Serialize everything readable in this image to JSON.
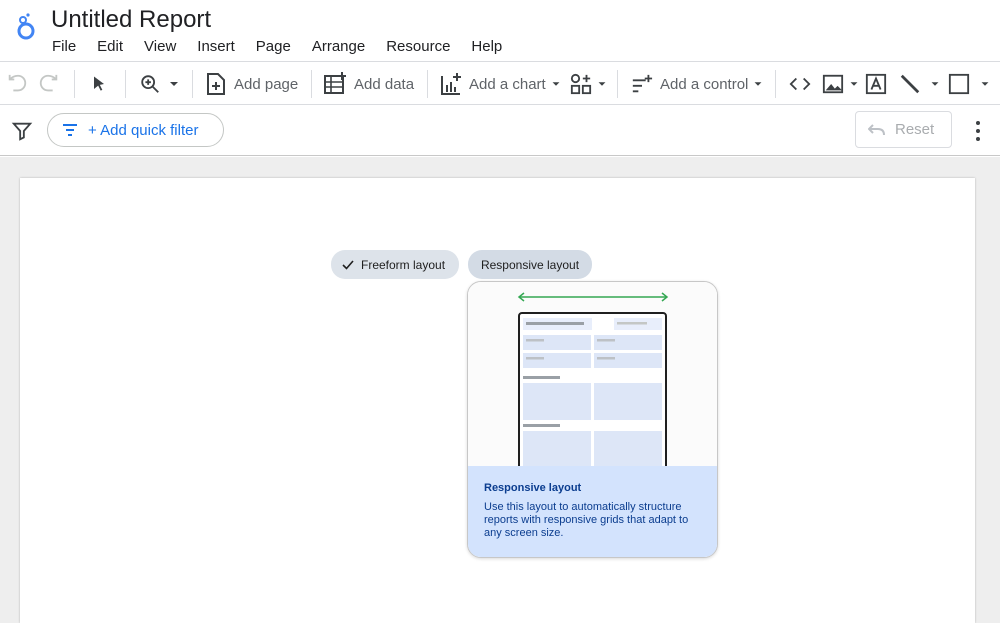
{
  "app": {
    "title": "Untitled Report"
  },
  "menu": [
    "File",
    "Edit",
    "View",
    "Insert",
    "Page",
    "Arrange",
    "Resource",
    "Help"
  ],
  "toolbar": {
    "add_page": "Add page",
    "add_data": "Add data",
    "add_chart": "Add a chart",
    "add_control": "Add a control"
  },
  "filterbar": {
    "quick_filter": "+ Add quick filter",
    "reset": "Reset"
  },
  "layout_options": {
    "freeform": "Freeform layout",
    "responsive": "Responsive layout",
    "selected": "Freeform layout"
  },
  "preview": {
    "title": "Responsive layout",
    "description": "Use this layout to automatically structure reports with responsive grids that adapt to any screen size."
  },
  "colors": {
    "accent": "#1a73e8",
    "arrow": "#34a853",
    "info_bg": "#d3e3fd",
    "info_text": "#0b3d8f"
  }
}
